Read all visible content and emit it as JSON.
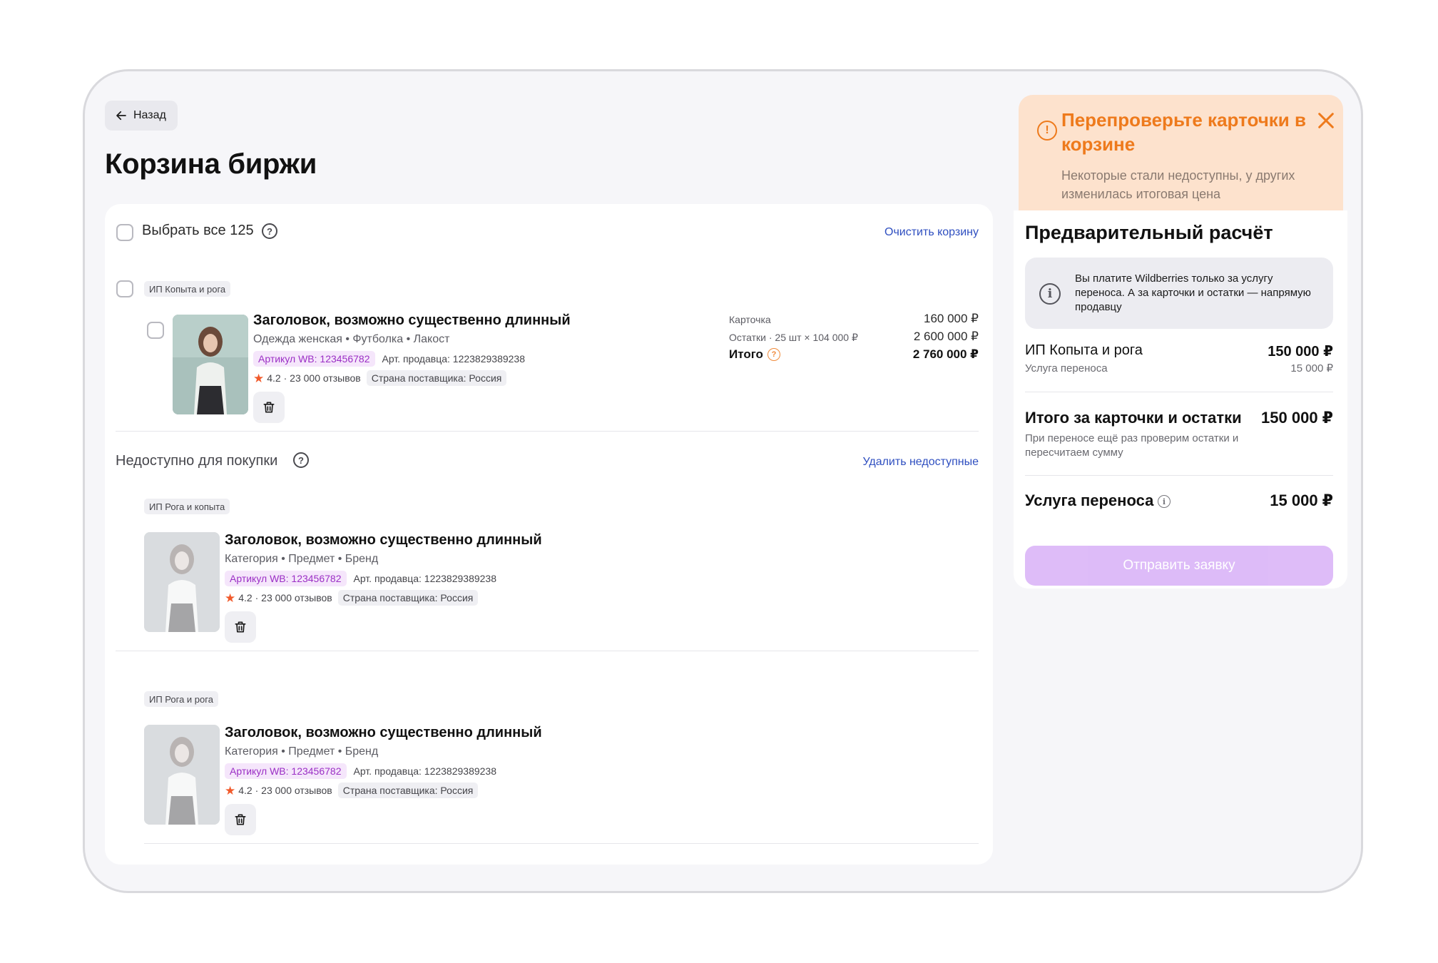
{
  "header": {
    "back_label": "Назад",
    "title": "Корзина биржи"
  },
  "cart": {
    "select_all_label": "Выбрать все 125",
    "clear_label": "Очистить корзину",
    "groups": [
      {
        "seller": "ИП Копыта и рога",
        "item": {
          "title": "Заголовок, возможно существенно длинный",
          "subtitle": "Одежда женская • Футболка • Лакост",
          "article_wb": "Артикул WB: 123456782",
          "seller_article": "Арт. продавца: 1223829389238",
          "rating": "4.2 · 23 000 отзывов",
          "country": "Страна поставщика: Россия",
          "prices": {
            "card_label": "Карточка",
            "card_value": "160 000 ₽",
            "stock_label": "Остатки · 25 шт × 104 000 ₽",
            "stock_value": "2 600 000 ₽",
            "total_label": "Итого",
            "total_value": "2 760 000 ₽"
          }
        }
      }
    ],
    "unavailable": {
      "title": "Недоступно для покупки",
      "remove_label": "Удалить недоступные",
      "groups": [
        {
          "seller": "ИП Рога и копыта",
          "item": {
            "title": "Заголовок, возможно существенно длинный",
            "subtitle": "Категория • Предмет • Бренд",
            "article_wb": "Артикул WB: 123456782",
            "seller_article": "Арт. продавца: 1223829389238",
            "rating": "4.2 · 23 000 отзывов",
            "country": "Страна поставщика: Россия"
          }
        },
        {
          "seller": "ИП Рога и рога",
          "item": {
            "title": "Заголовок, возможно существенно длинный",
            "subtitle": "Категория • Предмет • Бренд",
            "article_wb": "Артикул WB: 123456782",
            "seller_article": "Арт. продавца: 1223829389238",
            "rating": "4.2 · 23 000 отзывов",
            "country": "Страна поставщика: Россия"
          }
        }
      ]
    }
  },
  "alert": {
    "title": "Перепроверьте карточки в корзине",
    "text": "Некоторые стали недоступны, у других изменилась итоговая цена"
  },
  "summary": {
    "title": "Предварительный расчёт",
    "info_text": "Вы платите Wildberries только за услугу переноса. А за карточки и остатки — напрямую продавцу",
    "seller_name": "ИП Копыта и рога",
    "seller_amount": "150 000 ₽",
    "seller_service_label": "Услуга переноса",
    "seller_service_amount": "15 000 ₽",
    "total_label": "Итого за карточки и остатки",
    "total_amount": "150 000 ₽",
    "total_note": "При переносе ещё раз проверим остатки и пересчитаем сумму",
    "service_label": "Услуга переноса",
    "service_amount": "15 000 ₽",
    "submit_label": "Отправить заявку"
  },
  "colors": {
    "accent_orange": "#ee7a1c",
    "alert_bg": "#fde2cd",
    "link_blue": "#2f4fc0",
    "article_purple": "#9b2fc5",
    "submit_disabled": "#dcb8f8"
  }
}
